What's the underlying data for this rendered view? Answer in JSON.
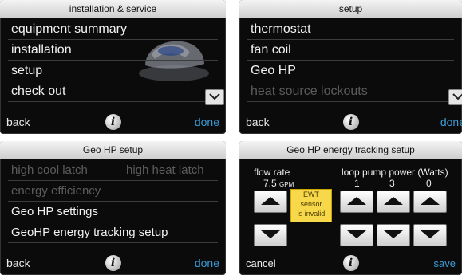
{
  "panels": {
    "installation_service": {
      "title": "installation & service",
      "items": [
        "equipment summary",
        "installation",
        "setup",
        "check out"
      ],
      "back": "back",
      "done": "done"
    },
    "setup": {
      "title": "setup",
      "items": [
        "thermostat",
        "fan coil",
        "Geo HP",
        "heat source lockouts"
      ],
      "back": "back",
      "done": "done"
    },
    "geo_hp_setup": {
      "title": "Geo HP setup",
      "row1_left": "high cool latch",
      "row1_right": "high heat latch",
      "items": [
        "energy efficiency",
        "Geo HP settings",
        "GeoHP energy tracking setup"
      ],
      "back": "back",
      "done": "done"
    },
    "energy_tracking": {
      "title": "Geo HP energy tracking setup",
      "flow_rate_label": "flow rate",
      "flow_rate_value": "7.5",
      "flow_rate_unit": "GPM",
      "loop_pump_label": "loop pump power (Watts)",
      "loop_values": [
        "1",
        "3",
        "0"
      ],
      "ewt_warning": [
        "EWT",
        "sensor",
        "is invalid"
      ],
      "cancel": "cancel",
      "save": "save"
    }
  },
  "colors": {
    "panel_bg": "#0b0b0b",
    "accent_blue": "#3a9bd6",
    "dim_text": "#5c5c5c",
    "warning_yellow": "#f7d84a"
  },
  "icons": [
    "info-icon",
    "chevron-down-icon",
    "arrow-up-icon",
    "arrow-down-icon",
    "cap-logo-icon"
  ]
}
